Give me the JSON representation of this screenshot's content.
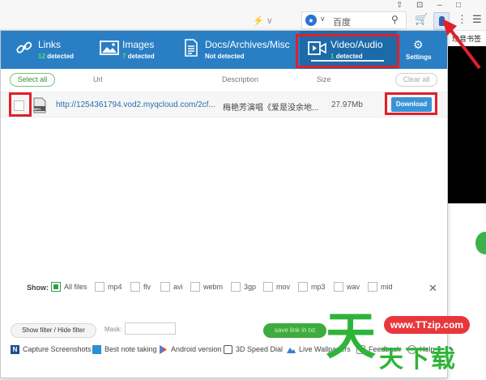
{
  "browser": {
    "window_controls": [
      "⇧",
      "⊡",
      "–",
      "□"
    ],
    "search_engine_name": "百度",
    "address_hint": "⚡ ∨",
    "page_side_text": "珍音书签"
  },
  "tabs": [
    {
      "label": "Links",
      "count": "12",
      "suffix": "detected",
      "icon": "link-icon"
    },
    {
      "label": "Images",
      "count": "7",
      "suffix": "detected",
      "icon": "image-icon"
    },
    {
      "label": "Docs/Archives/Misc",
      "count": "",
      "suffix": "Not detected",
      "icon": "document-icon"
    },
    {
      "label": "Video/Audio",
      "count": "1",
      "suffix": "detected",
      "icon": "video-icon",
      "active": true
    }
  ],
  "settings_label": "Settings",
  "header": {
    "select_all": "Select all",
    "col_url": "Url",
    "col_description": "Description",
    "col_size": "Size",
    "clear_all": "Clear all"
  },
  "files": [
    {
      "url": "http://1254361794.vod2.myqcloud.com/2cf...",
      "description": "梅艳芳演唱《爱是没余地...",
      "size": "27.97Mb",
      "type_badge": "MP4",
      "checked": false,
      "download_label": "Download"
    }
  ],
  "show_filter": {
    "label": "Show:",
    "types": [
      {
        "label": "All files",
        "checked": true
      },
      {
        "label": "mp4",
        "checked": false
      },
      {
        "label": "flv",
        "checked": false
      },
      {
        "label": "avi",
        "checked": false
      },
      {
        "label": "webm",
        "checked": false
      },
      {
        "label": "3gp",
        "checked": false
      },
      {
        "label": "mov",
        "checked": false
      },
      {
        "label": "mp3",
        "checked": false
      },
      {
        "label": "wav",
        "checked": false
      },
      {
        "label": "mid",
        "checked": false
      }
    ]
  },
  "bottom": {
    "filter_toggle": "Show filter / Hide filter",
    "mask_label": "Mask:",
    "mask_value": "",
    "save_link": "save link in txt"
  },
  "footer_links": [
    {
      "label": "Capture Screenshots",
      "icon": "screenshot-icon",
      "color": "#1d4f91"
    },
    {
      "label": "Best note taking",
      "icon": "note-icon",
      "color": "#2a8fd6"
    },
    {
      "label": "Android version",
      "icon": "android-play-icon",
      "color": "#e2443a"
    },
    {
      "label": "3D Speed Dial",
      "icon": "speed-dial-icon",
      "color": "#555555"
    },
    {
      "label": "Live Wallpapers",
      "icon": "wallpaper-icon",
      "color": "#3b7fd0"
    },
    {
      "label": "Feedback",
      "icon": "feedback-icon",
      "color": "#888888"
    },
    {
      "label": "Help",
      "icon": "help-icon",
      "color": "#888888"
    }
  ],
  "watermark": {
    "site": "www.TTzip.com",
    "big_char": "天",
    "chinese": "天下载"
  },
  "colors": {
    "tabbar": "#2a7fc4",
    "accent_green": "#2f9e44",
    "download_blue": "#3a93d6",
    "annotation_red": "#e0202b"
  }
}
